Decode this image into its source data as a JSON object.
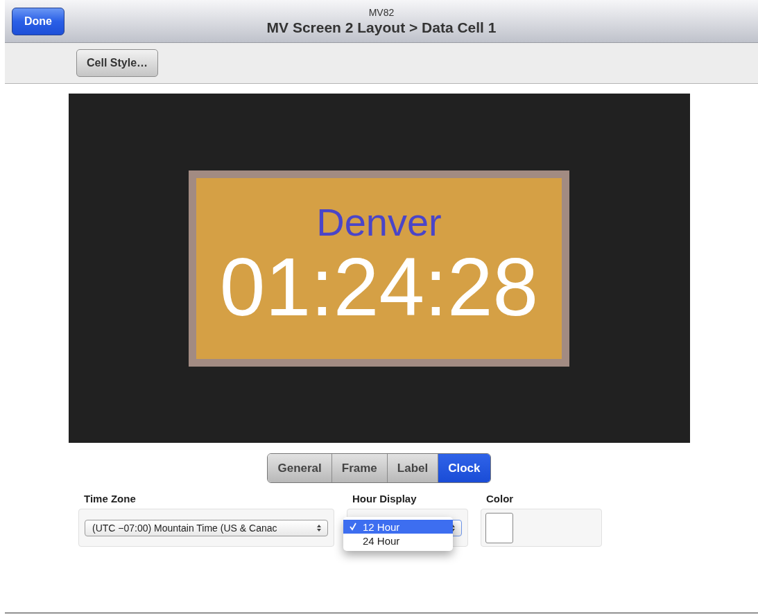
{
  "header": {
    "subtitle": "MV82",
    "title": "MV Screen 2 Layout > Data Cell 1",
    "done_button": "Done"
  },
  "toolbar": {
    "cell_style_button": "Cell Style…"
  },
  "preview": {
    "label": "Denver",
    "time": "01:24:28"
  },
  "tabs": [
    {
      "label": "General",
      "selected": false
    },
    {
      "label": "Frame",
      "selected": false
    },
    {
      "label": "Label",
      "selected": false
    },
    {
      "label": "Clock",
      "selected": true
    }
  ],
  "time_zone": {
    "label": "Time Zone",
    "value": "(UTC −07:00) Mountain Time (US & Canac"
  },
  "hour_display": {
    "label": "Hour Display",
    "options": [
      {
        "label": "12 Hour",
        "selected": true
      },
      {
        "label": "24 Hour",
        "selected": false
      }
    ]
  },
  "color": {
    "label": "Color",
    "color": "#ffffff"
  }
}
